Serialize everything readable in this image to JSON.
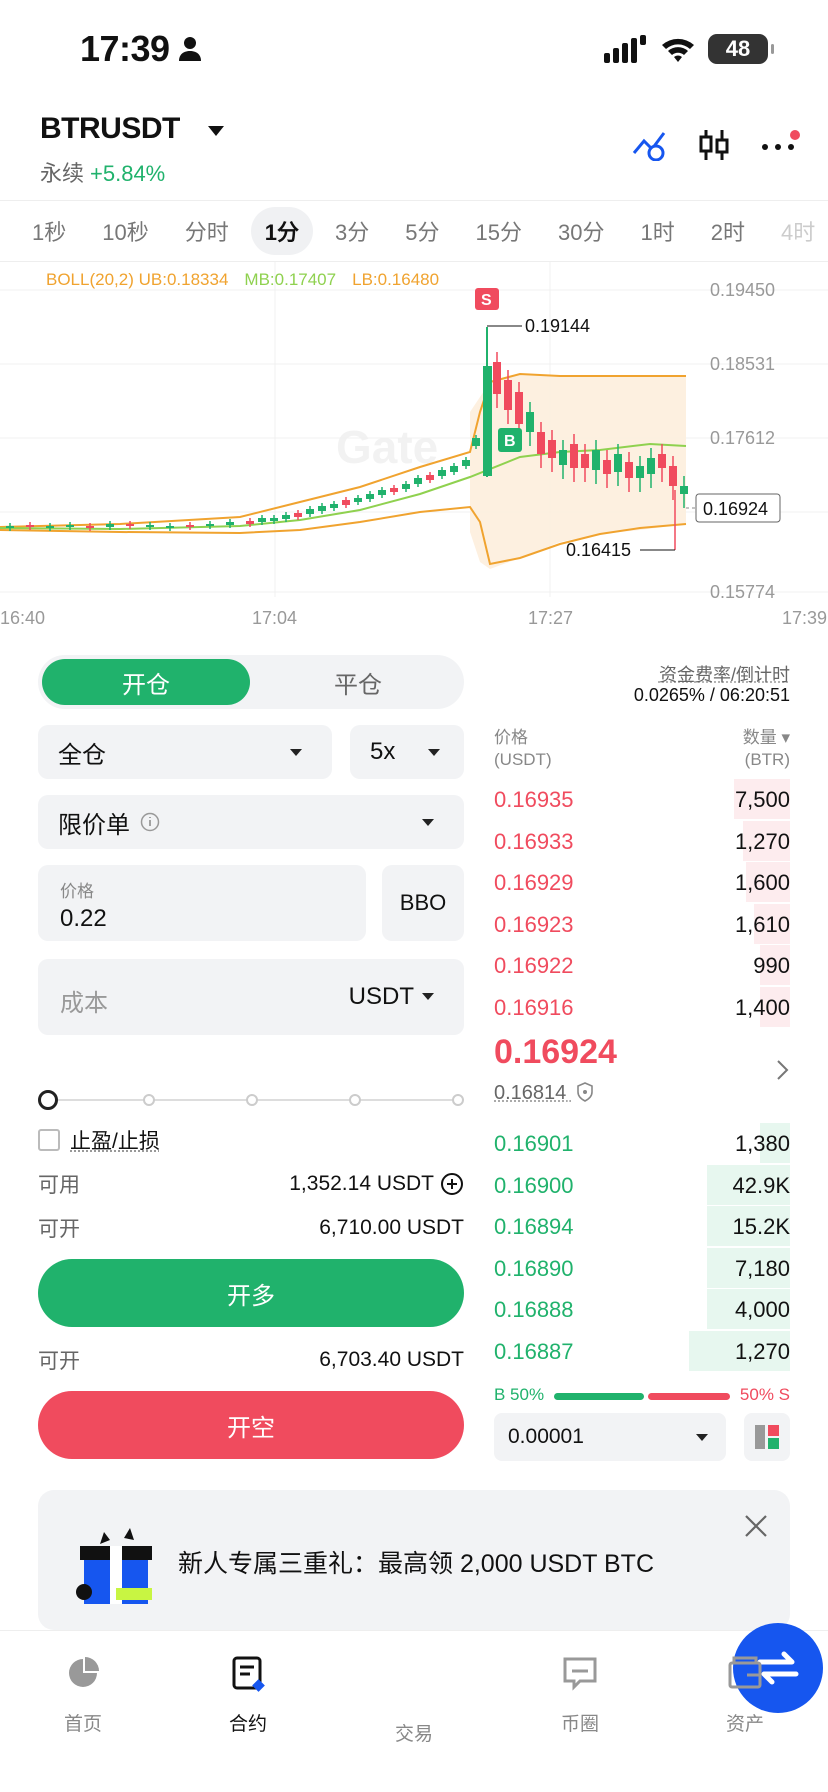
{
  "status_bar": {
    "time": "17:39",
    "battery": "48"
  },
  "header": {
    "pair": "BTRUSDT",
    "type": "永续",
    "change": "+5.84%"
  },
  "time_tabs": [
    "1秒",
    "10秒",
    "分时",
    "1分",
    "3分",
    "5分",
    "15分",
    "30分",
    "1时",
    "2时",
    "4时"
  ],
  "active_tab_index": 3,
  "chart": {
    "legend": {
      "boll": "BOLL(20,2)",
      "ub": "UB:0.18334",
      "mb": "MB:0.17407",
      "lb": "LB:0.16480"
    },
    "y_ticks": [
      "0.19450",
      "0.18531",
      "0.17612",
      "0.16924",
      "0.15774"
    ],
    "x_ticks": [
      "16:40",
      "17:04",
      "17:27",
      "17:39"
    ],
    "high_label": "0.19144",
    "low_label": "0.16415",
    "current_price_tag": "0.16924",
    "markers": {
      "sell": "S",
      "buy": "B"
    },
    "watermark": "Gate",
    "colors": {
      "up": "#20b26c",
      "down": "#f04b5e",
      "ub": "#f0a32f",
      "mb": "#8fd14f",
      "lb": "#f0a32f"
    }
  },
  "order_form": {
    "tab_open": "开仓",
    "tab_close": "平仓",
    "margin_mode": "全仓",
    "leverage": "5x",
    "order_type": "限价单",
    "price_label": "价格",
    "price_value": "0.22",
    "bbo": "BBO",
    "cost_label": "成本",
    "cost_unit": "USDT",
    "tpsl_label": "止盈/止损",
    "available_label": "可用",
    "available_value": "1,352.14 USDT",
    "open_long_label": "可开",
    "open_long_value": "6,710.00 USDT",
    "btn_long": "开多",
    "open_short_label": "可开",
    "open_short_value": "6,703.40 USDT",
    "btn_short": "开空"
  },
  "orderbook": {
    "funding_label": "资金费率/倒计时",
    "funding_value": "0.0265% / 06:20:51",
    "price_header": "价格",
    "price_unit": "(USDT)",
    "qty_header": "数量",
    "qty_unit": "(BTR)",
    "asks": [
      {
        "price": "0.16935",
        "qty": "7,500",
        "depth": 0.19
      },
      {
        "price": "0.16933",
        "qty": "1,270",
        "depth": 0.16
      },
      {
        "price": "0.16929",
        "qty": "1,600",
        "depth": 0.15
      },
      {
        "price": "0.16923",
        "qty": "1,610",
        "depth": 0.12
      },
      {
        "price": "0.16922",
        "qty": "990",
        "depth": 0.1
      },
      {
        "price": "0.16916",
        "qty": "1,400",
        "depth": 0.1
      }
    ],
    "last_price": "0.16924",
    "mark_price": "0.16814",
    "bids": [
      {
        "price": "0.16901",
        "qty": "1,380",
        "depth": 0.1
      },
      {
        "price": "0.16900",
        "qty": "42.9K",
        "depth": 0.28
      },
      {
        "price": "0.16894",
        "qty": "15.2K",
        "depth": 0.28
      },
      {
        "price": "0.16890",
        "qty": "7,180",
        "depth": 0.28
      },
      {
        "price": "0.16888",
        "qty": "4,000",
        "depth": 0.28
      },
      {
        "price": "0.16887",
        "qty": "1,270",
        "depth": 0.34
      }
    ],
    "buy_ratio": "B 50%",
    "sell_ratio": "50% S",
    "precision": "0.00001"
  },
  "promo": {
    "text": "新人专属三重礼：最高领 2,000 USDT BTC"
  },
  "bottom_nav": [
    {
      "label": "首页"
    },
    {
      "label": "合约"
    },
    {
      "label": "交易"
    },
    {
      "label": "币圈"
    },
    {
      "label": "资产"
    }
  ],
  "active_nav_index": 1
}
